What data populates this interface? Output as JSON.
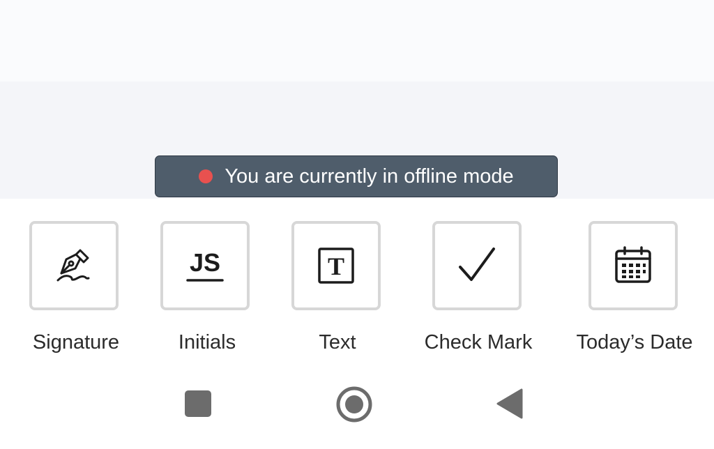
{
  "banner": {
    "status_color": "#e8514f",
    "text": "You are currently in offline mode"
  },
  "tools": [
    {
      "label": "Signature",
      "icon": "signature-pen-icon"
    },
    {
      "label": "Initials",
      "icon": "initials-icon",
      "icon_text": "JS"
    },
    {
      "label": "Text",
      "icon": "text-box-icon",
      "icon_text": "T"
    },
    {
      "label": "Check Mark",
      "icon": "checkmark-icon"
    },
    {
      "label": "Today’s Date",
      "icon": "calendar-icon"
    }
  ],
  "navigation": {
    "buttons": [
      {
        "name": "recents",
        "icon": "square-icon"
      },
      {
        "name": "home",
        "icon": "circle-home-icon"
      },
      {
        "name": "back",
        "icon": "back-triangle-icon"
      }
    ]
  }
}
